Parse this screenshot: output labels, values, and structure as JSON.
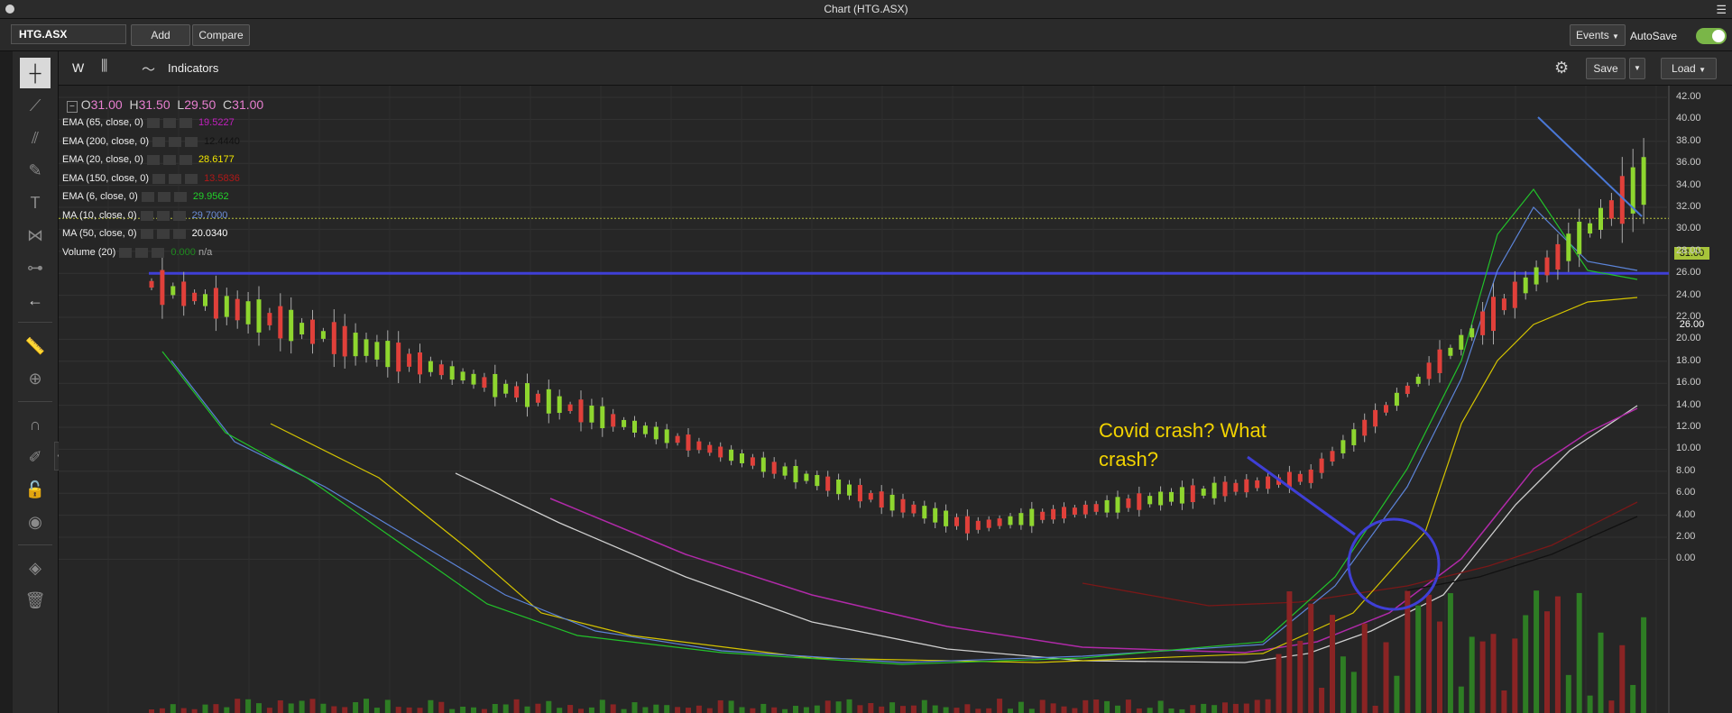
{
  "window": {
    "title": "Chart (HTG.ASX)"
  },
  "toolbar": {
    "symbol_value": "HTG.ASX",
    "add_label": "Add",
    "compare_label": "Compare",
    "events_label": "Events",
    "autosave_label": "AutoSave",
    "autosave_on": true
  },
  "chart_header": {
    "interval_label": "W",
    "indicators_label": "Indicators",
    "save_label": "Save",
    "load_label": "Load"
  },
  "ohlc": {
    "open_prefix": "O",
    "open": "31.00",
    "high_prefix": "H",
    "high": "31.50",
    "low_prefix": "L",
    "low": "29.50",
    "close_prefix": "C",
    "close": "31.00"
  },
  "legend": [
    {
      "label": "EMA (65, close, 0)",
      "value": "19.5227",
      "color": "#c21fbf"
    },
    {
      "label": "EMA (200, close, 0)",
      "value": "12.4440",
      "color": "#111111"
    },
    {
      "label": "EMA (20, close, 0)",
      "value": "28.6177",
      "color": "#f2e600"
    },
    {
      "label": "EMA (150, close, 0)",
      "value": "13.5836",
      "color": "#b01818"
    },
    {
      "label": "EMA (6, close, 0)",
      "value": "29.9562",
      "color": "#22d12a"
    },
    {
      "label": "MA (10, close, 0)",
      "value": "29.7000",
      "color": "#6c8ed8"
    },
    {
      "label": "MA (50, close, 0)",
      "value": "20.0340",
      "color": "#ffffff"
    },
    {
      "label": "Volume (20)",
      "value": "n/a",
      "color": "#1f8a1f",
      "volume_value": "0.000"
    }
  ],
  "price_axis": [
    "42.00",
    "40.00",
    "38.00",
    "36.00",
    "34.00",
    "32.00",
    "30.00",
    "28.00",
    "26.00",
    "24.00",
    "22.00",
    "20.00",
    "18.00",
    "16.00",
    "14.00",
    "12.00",
    "10.00",
    "8.00",
    "6.00",
    "4.00",
    "2.00",
    "0.00"
  ],
  "current_price_tag": "31.00",
  "level_tag": "26.00",
  "annotation": {
    "line1": "Covid crash?  What",
    "line2": "crash?"
  },
  "colors": {
    "up": "#8ed62f",
    "down": "#e0403a",
    "hline": "#3f3fd6",
    "annotation": "#f2d300",
    "trend": "#4a78d6"
  }
}
